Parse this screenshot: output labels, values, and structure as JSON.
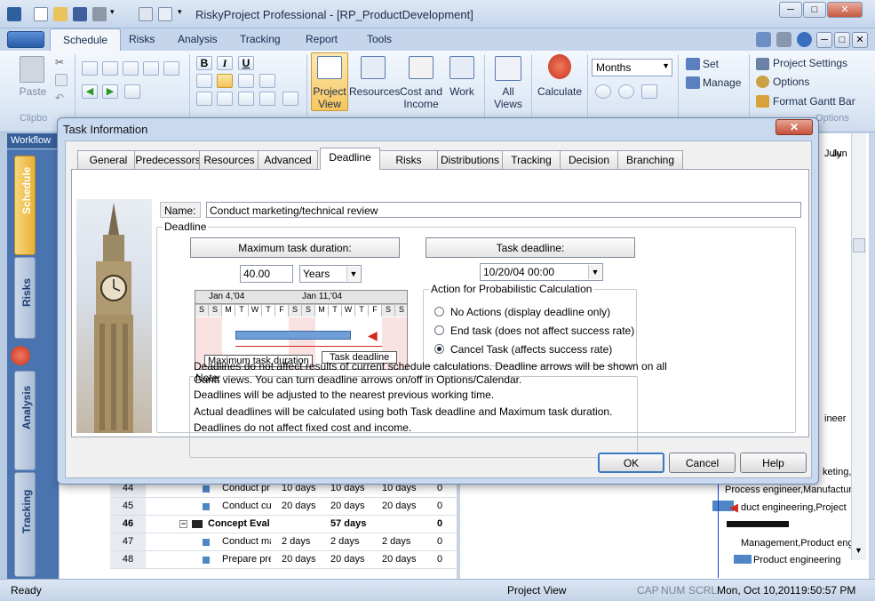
{
  "app": {
    "title": "RiskyProject Professional - [RP_ProductDevelopment]",
    "window_buttons": {
      "minimize": "─",
      "restore": "□",
      "close": "✕"
    },
    "doc_buttons": {
      "minimize": "─",
      "restore": "□",
      "close": "✕"
    }
  },
  "ribbon": {
    "tabs": [
      "Schedule",
      "Risks",
      "Analysis",
      "Tracking",
      "Report",
      "Tools"
    ],
    "active_tab": "Schedule",
    "paste_label": "Paste",
    "clipboard_caption": "Clipbo",
    "large_buttons": [
      {
        "label": "Project\nView"
      },
      {
        "label": "Resources"
      },
      {
        "label": "Cost and\nIncome"
      },
      {
        "label": "Work"
      },
      {
        "label": "All\nViews"
      },
      {
        "label": "Calculate"
      }
    ],
    "project_view_1": "Project",
    "project_view_2": "View",
    "resources": "Resources",
    "cost_1": "Cost and",
    "cost_2": "Income",
    "work": "Work",
    "all_views_1": "All",
    "all_views_2": "Views",
    "calculate": "Calculate",
    "timescale": "Months",
    "set_label": "Set",
    "manage_label": "Manage",
    "project_settings": "Project Settings",
    "options": "Options",
    "format_gantt_bar": "Format Gantt Bar",
    "options_caption": "Options",
    "format_buttons": [
      "B",
      "I",
      "U"
    ]
  },
  "sidebar": {
    "workflow": "Workflow",
    "tabs": [
      "Schedule",
      "Risks",
      "Analysis",
      "Tracking"
    ],
    "active": "Schedule"
  },
  "grid": {
    "rows": [
      {
        "id": "44",
        "name": "Conduct pr",
        "dur": "10 days",
        "d2": "10 days",
        "d3": "10 days",
        "v": "0"
      },
      {
        "id": "45",
        "name": "Conduct cu",
        "dur": "20 days",
        "d2": "20 days",
        "d3": "20 days",
        "v": "0"
      },
      {
        "id": "46",
        "name": "Concept Eval",
        "dur": "",
        "d2": "57 days",
        "d3": "",
        "v": "0"
      },
      {
        "id": "47",
        "name": "Conduct ma",
        "dur": "2 days",
        "d2": "2 days",
        "d3": "2 days",
        "v": "0"
      },
      {
        "id": "48",
        "name": "Prepare pre",
        "dur": "20 days",
        "d2": "20 days",
        "d3": "20 days",
        "v": "0"
      }
    ],
    "fragments": {
      "pr": "Pr",
      "r": "R",
      "a": "A"
    }
  },
  "gantt": {
    "header": [
      "July",
      "Jun"
    ],
    "labels": [
      "ineer",
      "keting,P",
      "Process engineer,Manufactur",
      "duct engineering,Project",
      "Management,Product engi",
      "Product engineering"
    ]
  },
  "dialog": {
    "title": "Task Information",
    "close": "✕",
    "tabs": [
      "General",
      "Predecessors",
      "Resources",
      "Advanced",
      "Deadline",
      "Risks",
      "Distributions",
      "Tracking",
      "Decision",
      "Branching"
    ],
    "active_tab": "Deadline",
    "name_label": "Name:",
    "name_value": "Conduct marketing/technical review",
    "deadline_group": "Deadline",
    "max_duration_header": "Maximum task duration:",
    "max_duration_value": "40.00",
    "duration_unit": "Years",
    "task_deadline_header": "Task deadline:",
    "task_deadline_value": "10/20/04 00:00",
    "illustration": {
      "week1": "Jan 4,'04",
      "week2": "Jan 11,'04",
      "days": [
        "S",
        "S",
        "M",
        "T",
        "W",
        "T",
        "F",
        "S",
        "S",
        "M",
        "T",
        "W",
        "T",
        "F",
        "S",
        "S"
      ],
      "max_label": "Maximum task duration",
      "deadline_label": "Task deadline"
    },
    "action_group": "Action for Probabilistic Calculation",
    "actions": [
      {
        "label": "No Actions (display deadline only)",
        "selected": false
      },
      {
        "label": "End task (does not affect success rate)",
        "selected": false
      },
      {
        "label": "Cancel Task (affects success rate)",
        "selected": true
      }
    ],
    "note_caption": "Note:",
    "notes": [
      "Deadlines do not affect results of current schedule calculations. Deadline arrows will be shown on all",
      "Gantt views. You can turn deadline arrows on/off in Options/Calendar.",
      "Deadlines will be adjusted to the nearest previous working time.",
      "Actual deadlines will be calculated using both Task deadline and Maximum task duration.",
      "Deadlines do not affect fixed cost and income."
    ],
    "ok": "OK",
    "cancel": "Cancel",
    "help": "Help"
  },
  "status": {
    "ready": "Ready",
    "view": "Project View",
    "cap": "CAP",
    "num": "NUM",
    "scrl": "SCRL",
    "datetime": "Mon, Oct 10,2011",
    "time": "9:50:57 PM"
  },
  "colors": {
    "ribbon_blue": "#c4d5ec",
    "accent_orange": "#e9b137",
    "bar_blue": "#4f86c6",
    "deadline_red": "#d22b1e"
  }
}
